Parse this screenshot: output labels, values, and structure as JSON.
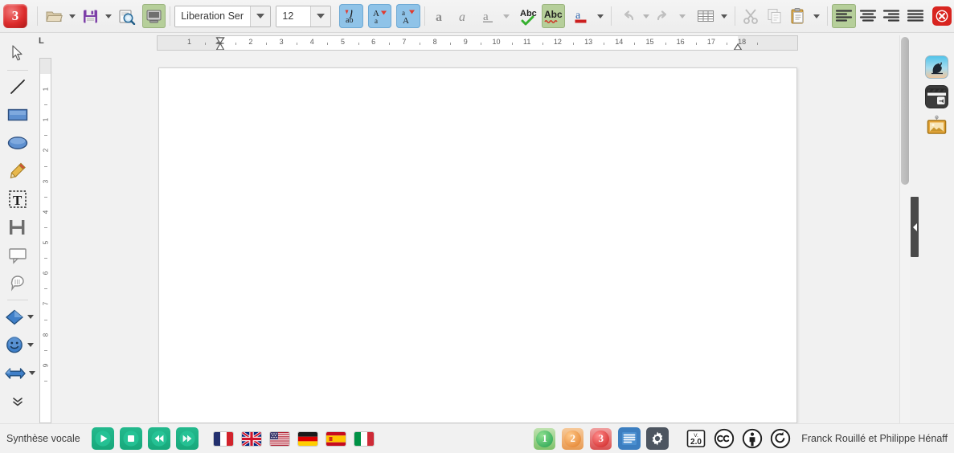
{
  "app": {
    "logo_label": "3",
    "accent_red": "#dd2c2c",
    "accent_green": "#b6cf9a",
    "accent_blue": "#8fc3e8",
    "tts_green": "#18a87b"
  },
  "toolbar": {
    "items": [
      {
        "name": "app-logo",
        "label": "3"
      },
      {
        "name": "open-button",
        "label": "Open",
        "has_caret": true
      },
      {
        "name": "save-button",
        "label": "Save",
        "has_caret": true
      },
      {
        "name": "print-preview-button",
        "label": "Print Preview"
      },
      {
        "name": "toggle-view-button",
        "label": "Toggle View",
        "state": "active"
      }
    ],
    "font_name": "Liberation Ser",
    "font_size": "12",
    "char_buttons": [
      {
        "name": "char-highlight-button",
        "label": "Character Highlighting",
        "state": "active"
      },
      {
        "name": "increase-size-button",
        "label": "Increase Font Size",
        "state": "active"
      },
      {
        "name": "decrease-size-button",
        "label": "Decrease Font Size",
        "state": "active"
      }
    ],
    "format_buttons": [
      {
        "name": "bold-button",
        "label": "Bold"
      },
      {
        "name": "italic-button",
        "label": "Italic"
      },
      {
        "name": "underline-button",
        "label": "Underline",
        "has_caret": true
      }
    ],
    "spell_buttons": [
      {
        "name": "spelling-check-button",
        "label": "Spelling",
        "glyph": "Abc"
      },
      {
        "name": "autospellcheck-button",
        "label": "AutoSpellcheck",
        "glyph": "Abc",
        "state": "active"
      }
    ],
    "font_color_label": "Font Color",
    "undo_label": "Undo",
    "redo_label": "Redo",
    "table_label": "Insert Table",
    "cut_label": "Cut",
    "copy_label": "Copy",
    "paste_label": "Paste",
    "align_buttons": [
      {
        "name": "align-left-button",
        "label": "Align Left",
        "state": "active"
      },
      {
        "name": "align-center-button",
        "label": "Align Center"
      },
      {
        "name": "align-right-button",
        "label": "Align Right"
      },
      {
        "name": "align-justify-button",
        "label": "Justified"
      }
    ],
    "close_label": "Close"
  },
  "left_tools": [
    {
      "name": "tool-select",
      "label": "Select"
    },
    {
      "name": "tool-line",
      "label": "Line"
    },
    {
      "name": "tool-rectangle",
      "label": "Rectangle"
    },
    {
      "name": "tool-ellipse",
      "label": "Ellipse"
    },
    {
      "name": "tool-freeform-line",
      "label": "Freeform Line"
    },
    {
      "name": "tool-text-box",
      "label": "Insert Text Box"
    },
    {
      "name": "tool-vertical-text",
      "label": "Vertical Text"
    },
    {
      "name": "tool-callout",
      "label": "Callout"
    },
    {
      "name": "tool-thought-bubble",
      "label": "Thought Bubble"
    },
    {
      "name": "tool-basic-shapes",
      "label": "Basic Shapes",
      "has_caret": true
    },
    {
      "name": "tool-symbol-shapes",
      "label": "Symbol Shapes",
      "has_caret": true
    },
    {
      "name": "tool-block-arrows",
      "label": "Block Arrows",
      "has_caret": true
    },
    {
      "name": "tool-more-options",
      "label": "More Options"
    }
  ],
  "ruler": {
    "unit_corner_label": "L",
    "tick_labels": [
      "1",
      "1",
      "2",
      "3",
      "4",
      "5",
      "6",
      "7",
      "8",
      "9",
      "10",
      "11",
      "12",
      "13",
      "14",
      "15",
      "16",
      "17",
      "18"
    ],
    "left_indent_pos": 2.0,
    "right_indent_pos": 17.0,
    "tab_stops": [
      3,
      4,
      5,
      6,
      7,
      8,
      9,
      10,
      11,
      12,
      13,
      14,
      15,
      16
    ],
    "vertical_labels": [
      "1",
      "1",
      "2",
      "3",
      "4",
      "5",
      "6",
      "7",
      "8",
      "9"
    ]
  },
  "right_sidebar": [
    {
      "name": "bird-icon",
      "label": "Bird Gallery"
    },
    {
      "name": "clapperboard-icon",
      "label": "Insert Video"
    },
    {
      "name": "picture-frame-icon",
      "label": "Insert Image"
    }
  ],
  "statusbar": {
    "tts_label": "Synthèse vocale",
    "tts_controls": [
      {
        "name": "tts-play-button",
        "label": "Lire"
      },
      {
        "name": "tts-stop-button",
        "label": "Arrêter"
      },
      {
        "name": "tts-rewind-button",
        "label": "Reculer"
      },
      {
        "name": "tts-forward-button",
        "label": "Avancer"
      }
    ],
    "languages": [
      {
        "name": "lang-french-button",
        "label": "Français"
      },
      {
        "name": "lang-english-uk-button",
        "label": "English (UK)"
      },
      {
        "name": "lang-english-us-button",
        "label": "English (US)"
      },
      {
        "name": "lang-german-button",
        "label": "Deutsch"
      },
      {
        "name": "lang-spanish-button",
        "label": "Español"
      },
      {
        "name": "lang-italian-button",
        "label": "Italiano"
      }
    ],
    "level_badges": [
      {
        "name": "level-1-button",
        "label": "1"
      },
      {
        "name": "level-2-button",
        "label": "2"
      },
      {
        "name": "level-3-button",
        "label": "3"
      }
    ],
    "view_button_label": "Affichage",
    "settings_button_label": "Paramètres",
    "license_version": "2.0",
    "license_version_prefix": "V.",
    "license_icons": [
      {
        "name": "creative-commons-icon",
        "label": "Creative Commons"
      },
      {
        "name": "attribution-icon",
        "label": "Attribution"
      },
      {
        "name": "share-alike-icon",
        "label": "Share Alike"
      }
    ],
    "attribution": "Franck Rouillé et Philippe Hénaff"
  }
}
